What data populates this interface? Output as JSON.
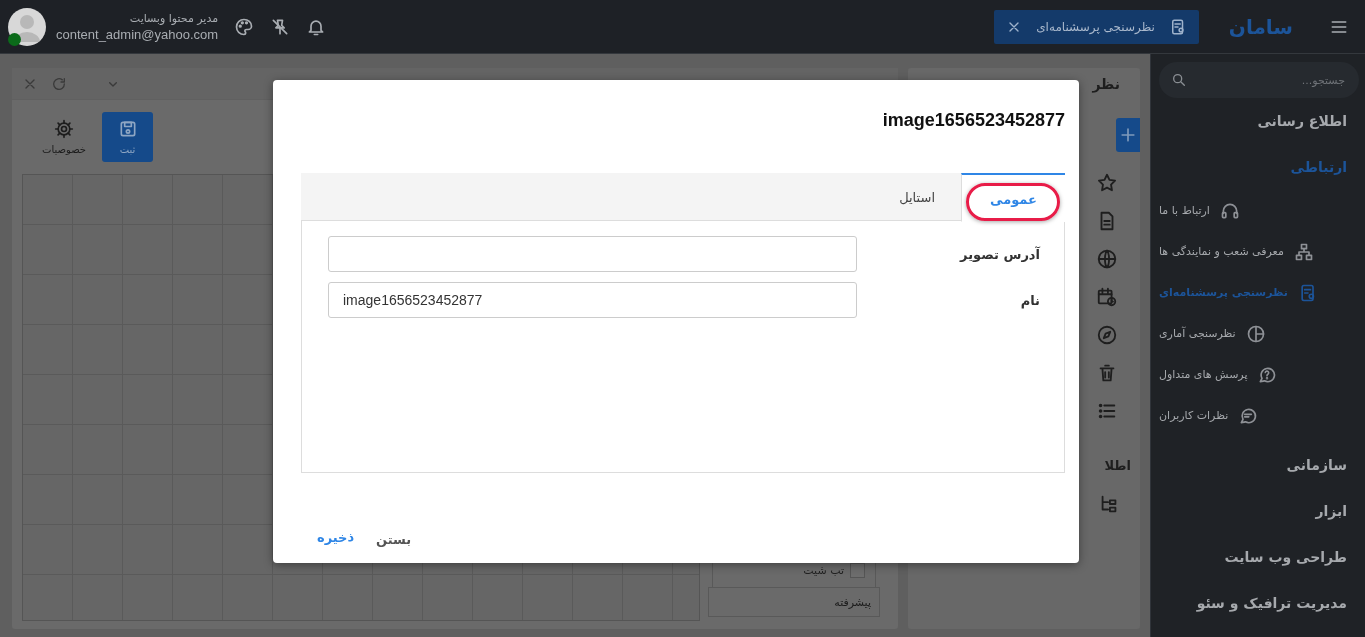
{
  "topbar": {
    "user": {
      "name": "مدیر محتوا وبسایت",
      "email": "content_admin@yahoo.com",
      "online": true
    },
    "open_tab": {
      "label": "نظرسنجی پرسشنامه‌ای"
    },
    "brand": "سامان"
  },
  "sidebar": {
    "search": {
      "placeholder": "جستجو..."
    },
    "sections": [
      {
        "label": "اطلاع رسانی",
        "expanded": false
      },
      {
        "label": "ارتباطی",
        "expanded": true,
        "children": [
          {
            "label": "ارتباط با ما",
            "selected": false
          },
          {
            "label": "معرفی شعب و نمایندگی ها",
            "selected": false
          },
          {
            "label": "نظرسنجی پرسشنامه‌ای",
            "selected": true
          },
          {
            "label": "نظرسنجی آماری",
            "selected": false
          },
          {
            "label": "پرسش های متداول",
            "selected": false
          },
          {
            "label": "نظرات کاربران",
            "selected": false
          }
        ]
      },
      {
        "label": "سازمانی",
        "expanded": false
      },
      {
        "label": "ابزار",
        "expanded": false
      },
      {
        "label": "طراحی وب سایت",
        "expanded": false
      },
      {
        "label": "مدیریت ترافیک و سئو",
        "expanded": false
      }
    ]
  },
  "editor": {
    "title": "نظر",
    "toolbar": [
      {
        "label": "ثبت",
        "kind": "primary"
      },
      {
        "label": "خصوصیات",
        "kind": "plain"
      }
    ],
    "properties": {
      "checkbox": {
        "label": "تب شیت",
        "checked": false
      },
      "section": "پیشرفته"
    },
    "side_label": "اطلا"
  },
  "dialog": {
    "title": "image1656523452877",
    "tabs": [
      {
        "label": "عمومی",
        "selected": true
      },
      {
        "label": "استایل",
        "selected": false
      }
    ],
    "fields": [
      {
        "label": "آدرس تصویر"
      },
      {
        "label": "نام",
        "value": "image1656523452877"
      }
    ],
    "buttons": [
      {
        "label": "بستن",
        "kind": "secondary"
      },
      {
        "label": "ذخیره",
        "kind": "primary"
      }
    ]
  }
}
